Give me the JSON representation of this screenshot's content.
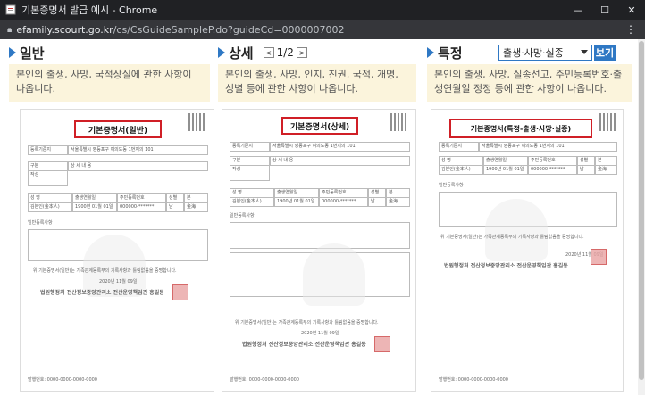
{
  "window": {
    "title": "기본증명서 발급 예시 - Chrome",
    "minimize": "—",
    "maximize": "☐",
    "close": "✕"
  },
  "address": {
    "host": "efamily.scourt.go.kr",
    "path": "/cs/CsGuideSampleP.do?guideCd=0000007002"
  },
  "columns": [
    {
      "heading": "일반",
      "description": "본인의 출생, 사망, 국적상실에 관한 사항이 나옵니다.",
      "doc_title": "기본증명서(일반)"
    },
    {
      "heading": "상세",
      "pager": {
        "prev": "<",
        "current": "1/2",
        "next": ">"
      },
      "description": "본인의 출생, 사망, 인지, 친권, 국적, 개명, 성별 등에 관한 사항이 나옵니다.",
      "doc_title": "기본증명서(상세)"
    },
    {
      "heading": "특정",
      "select_value": "출생·사망·실종",
      "view_button": "보기",
      "description": "본인의 출생, 사망, 실종선고, 주민등록번호·출생연월일 정정 등에 관한 사항이 나옵니다.",
      "doc_title": "기본증명서(특정-출생·사망·실종)"
    }
  ],
  "doc_text": {
    "registry": "등록기준지",
    "address": "서울특별시 영등포구 여의도동 1번지의 101",
    "section": "구분",
    "detail": "상 세 내 용",
    "report": "작성",
    "name_h": "성 명",
    "birth_h": "출생연월일",
    "rrn_h": "주민등록번호",
    "sex_h": "성별",
    "seal_h": "본",
    "person": "본인",
    "name": "김본인(金本人)",
    "birth": "1900년 01월 01일",
    "rrn": "000000-*******",
    "sex": "남",
    "seal": "金海",
    "general": "일반등록사항",
    "certify": "위 기본증명서(일반)는 가족관계등록부의 기록사항과 틀림없음을 증명합니다.",
    "date": "2020년 11월 09일",
    "issuer": "법원행정처 전산정보중앙관리소 전산운영책임관 홍길동",
    "footer": "발행번호: 0000-0000-0000-0000"
  }
}
